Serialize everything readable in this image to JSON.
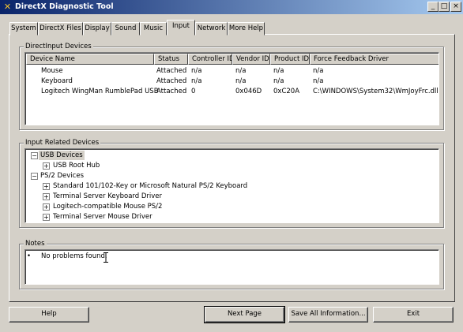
{
  "window": {
    "title": "DirectX Diagnostic Tool",
    "controls": {
      "minimize": "_",
      "maximize": "□",
      "close": "×"
    }
  },
  "tabs": [
    "System",
    "DirectX Files",
    "Display",
    "Sound",
    "Music",
    "Input",
    "Network",
    "More Help"
  ],
  "selected_tab": "Input",
  "directinput": {
    "legend": "DirectInput Devices",
    "columns": [
      "Device Name",
      "Status",
      "Controller ID",
      "Vendor ID",
      "Product ID",
      "Force Feedback Driver"
    ],
    "rows": [
      [
        "Mouse",
        "Attached",
        "n/a",
        "n/a",
        "n/a",
        "n/a"
      ],
      [
        "Keyboard",
        "Attached",
        "n/a",
        "n/a",
        "n/a",
        "n/a"
      ],
      [
        "Logitech WingMan RumblePad USB",
        "Attached",
        "0",
        "0x046D",
        "0xC20A",
        "C:\\WINDOWS\\System32\\WmJoyFrc.dll"
      ]
    ]
  },
  "related": {
    "legend": "Input Related Devices",
    "tree": [
      {
        "label": "USB Devices",
        "level": 0,
        "expander": "−",
        "selected": true
      },
      {
        "label": "USB Root Hub",
        "level": 1,
        "expander": "+"
      },
      {
        "label": "PS/2 Devices",
        "level": 0,
        "expander": "−"
      },
      {
        "label": "Standard 101/102-Key or Microsoft Natural PS/2 Keyboard",
        "level": 1,
        "expander": "+"
      },
      {
        "label": "Terminal Server Keyboard Driver",
        "level": 1,
        "expander": "+"
      },
      {
        "label": "Logitech-compatible Mouse PS/2",
        "level": 1,
        "expander": "+"
      },
      {
        "label": "Terminal Server Mouse Driver",
        "level": 1,
        "expander": "+"
      }
    ]
  },
  "notes": {
    "legend": "Notes",
    "items": [
      "No problems found."
    ]
  },
  "buttons": {
    "help": "Help",
    "next_page": "Next Page",
    "save_all": "Save All Information...",
    "exit": "Exit"
  }
}
